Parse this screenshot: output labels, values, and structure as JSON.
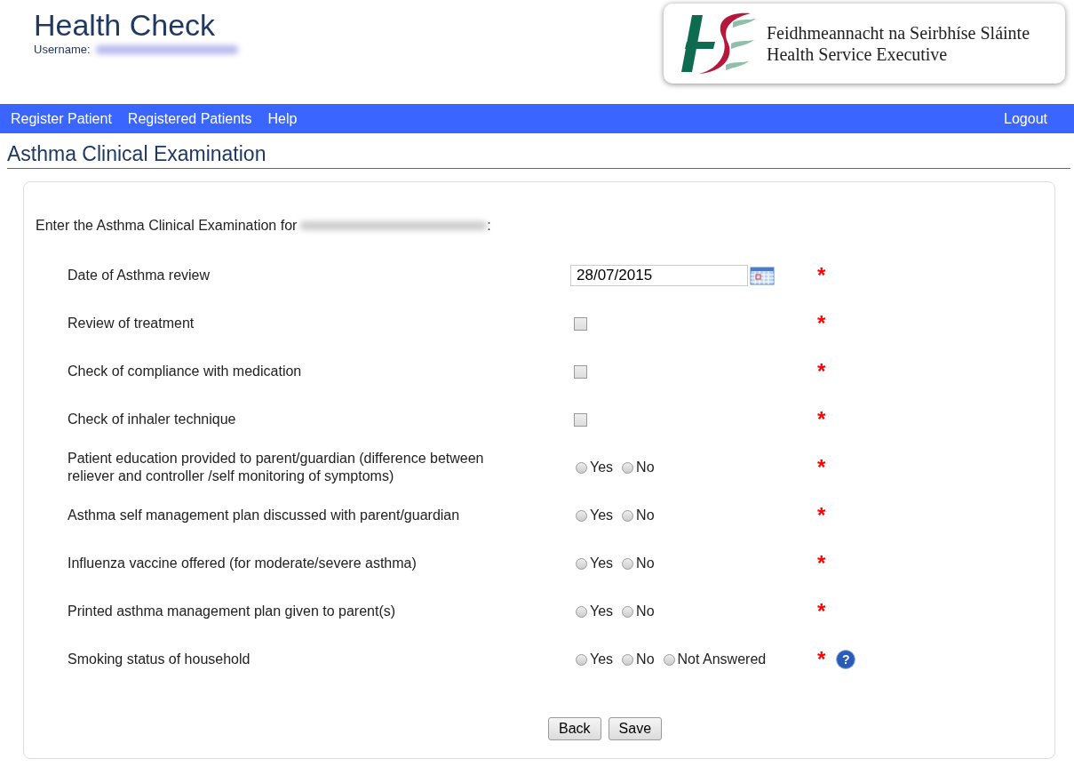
{
  "header": {
    "title": "Health Check",
    "username_label": "Username:"
  },
  "logo": {
    "line_1": "Feidhmeannacht na Seirbhíse Sláinte",
    "line_2": "Health Service Executive"
  },
  "nav": {
    "items": [
      {
        "label": "Register Patient"
      },
      {
        "label": "Registered Patients"
      },
      {
        "label": "Help"
      }
    ],
    "logout": "Logout"
  },
  "page_title": "Asthma Clinical Examination",
  "form": {
    "intro_prefix": "Enter the Asthma Clinical Examination for",
    "intro_suffix": ":",
    "fields": [
      {
        "kind": "date",
        "label": "Date of Asthma review",
        "value": "28/07/2015",
        "required": "*"
      },
      {
        "kind": "checkbox",
        "label": "Review of treatment",
        "checked": false,
        "required": "*"
      },
      {
        "kind": "checkbox",
        "label": "Check of compliance with medication",
        "checked": false,
        "required": "*"
      },
      {
        "kind": "checkbox",
        "label": "Check of inhaler technique",
        "checked": false,
        "required": "*"
      },
      {
        "kind": "radio",
        "label": "Patient education provided to parent/guardian (difference between reliever and controller /self monitoring of symptoms)",
        "options": [
          {
            "label": "Yes",
            "selected": false
          },
          {
            "label": "No",
            "selected": false
          }
        ],
        "required": "*"
      },
      {
        "kind": "radio",
        "label": "Asthma self management plan discussed with parent/guardian",
        "options": [
          {
            "label": "Yes",
            "selected": false
          },
          {
            "label": "No",
            "selected": false
          }
        ],
        "required": "*"
      },
      {
        "kind": "radio",
        "label": "Influenza vaccine offered (for moderate/severe asthma)",
        "options": [
          {
            "label": "Yes",
            "selected": false
          },
          {
            "label": "No",
            "selected": false
          }
        ],
        "required": "*"
      },
      {
        "kind": "radio",
        "label": "Printed asthma management plan given to parent(s)",
        "options": [
          {
            "label": "Yes",
            "selected": false
          },
          {
            "label": "No",
            "selected": false
          }
        ],
        "required": "*"
      },
      {
        "kind": "radio",
        "label": "Smoking status of household",
        "options": [
          {
            "label": "Yes",
            "selected": false
          },
          {
            "label": "No",
            "selected": false
          },
          {
            "label": "Not Answered",
            "selected": false
          }
        ],
        "required": "*",
        "help": "?"
      }
    ],
    "buttons": [
      "Back",
      "Save"
    ]
  }
}
